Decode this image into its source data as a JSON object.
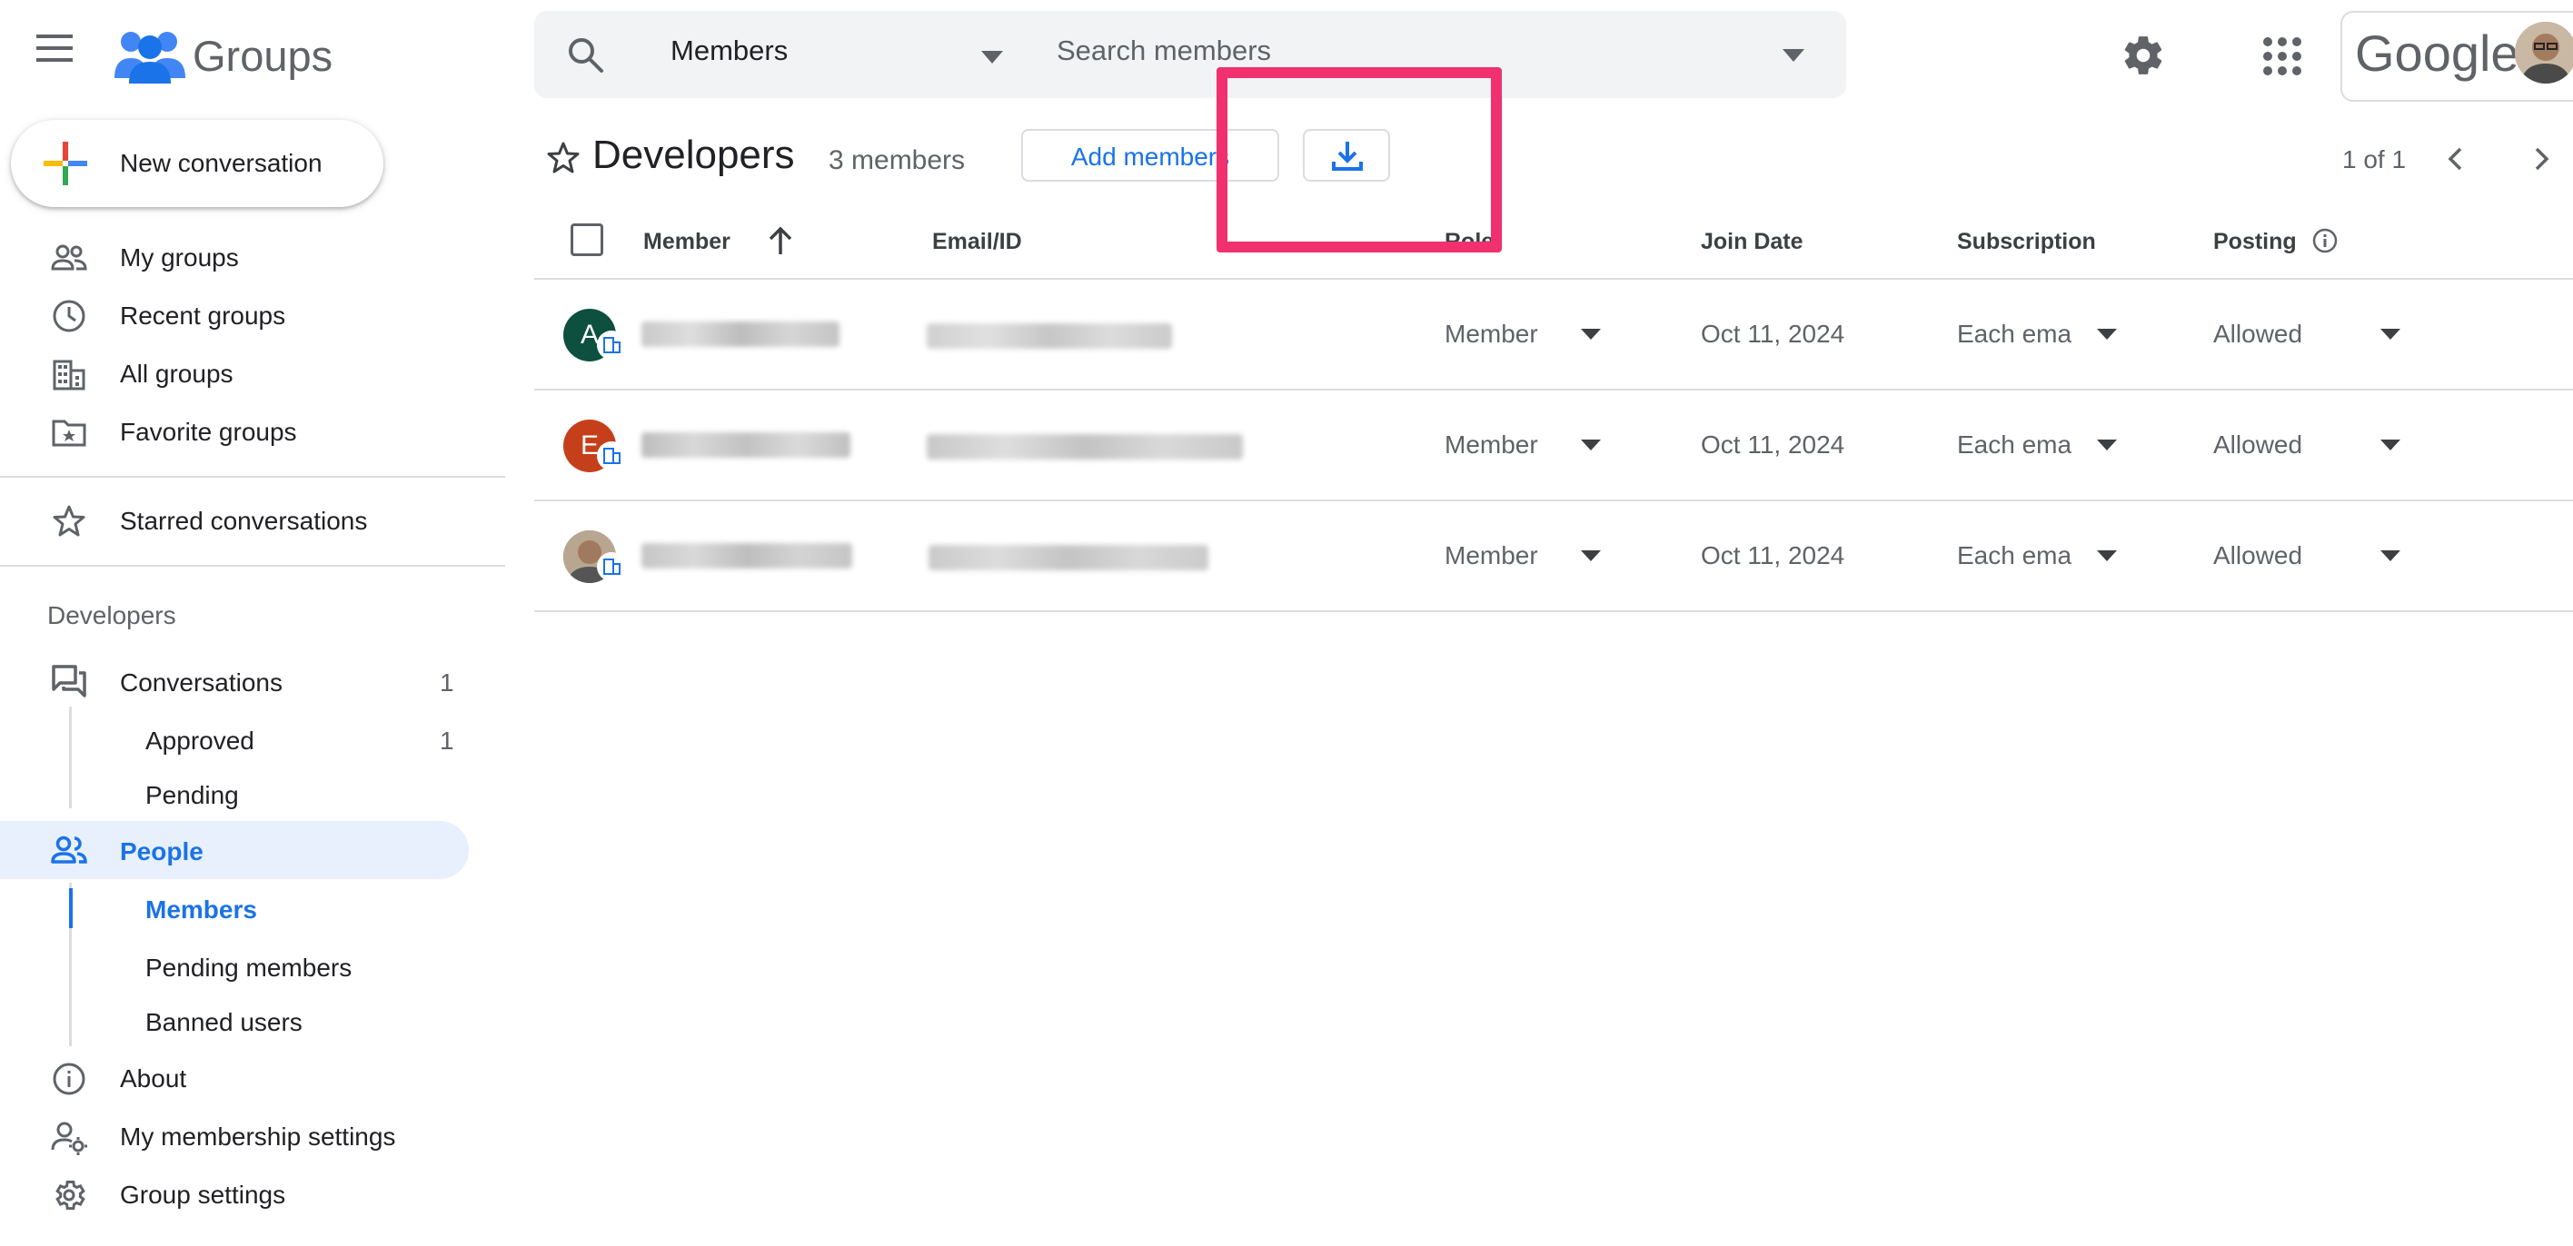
{
  "header": {
    "app_name": "Groups",
    "search_scope": "Members",
    "search_placeholder": "Search members",
    "account_brand": "Google"
  },
  "sidebar": {
    "new_conversation": "New conversation",
    "top_items": [
      {
        "label": "My groups",
        "icon": "people-outline-icon"
      },
      {
        "label": "Recent groups",
        "icon": "clock-icon"
      },
      {
        "label": "All groups",
        "icon": "building-icon"
      },
      {
        "label": "Favorite groups",
        "icon": "folder-star-icon"
      }
    ],
    "starred": "Starred conversations",
    "group_section_title": "Developers",
    "conversations": {
      "label": "Conversations",
      "count": "1"
    },
    "approved": {
      "label": "Approved",
      "count": "1"
    },
    "pending": "Pending",
    "people": "People",
    "members": "Members",
    "pending_members": "Pending members",
    "banned_users": "Banned users",
    "about": "About",
    "membership_settings": "My membership settings",
    "group_settings": "Group settings"
  },
  "main": {
    "group_title": "Developers",
    "member_count": "3 members",
    "add_members": "Add members",
    "pager": "1 of 1",
    "columns": {
      "member": "Member",
      "email": "Email/ID",
      "role": "Role",
      "join_date": "Join Date",
      "subscription": "Subscription",
      "posting": "Posting"
    },
    "rows": [
      {
        "initial": "A",
        "avatar_color": "#0d5040",
        "role": "Member",
        "join_date": "Oct 11, 2024",
        "subscription": "Each email",
        "posting": "Allowed"
      },
      {
        "initial": "E",
        "avatar_color": "#c5401a",
        "role": "Member",
        "join_date": "Oct 11, 2024",
        "subscription": "Each email",
        "posting": "Allowed"
      },
      {
        "initial": "",
        "avatar_color": "#9a8472",
        "role": "Member",
        "join_date": "Oct 11, 2024",
        "subscription": "Each email",
        "posting": "Allowed"
      }
    ]
  },
  "colors": {
    "accent": "#1a73e8",
    "highlight": "#f0306f",
    "active_bg": "#e8f0fe"
  }
}
